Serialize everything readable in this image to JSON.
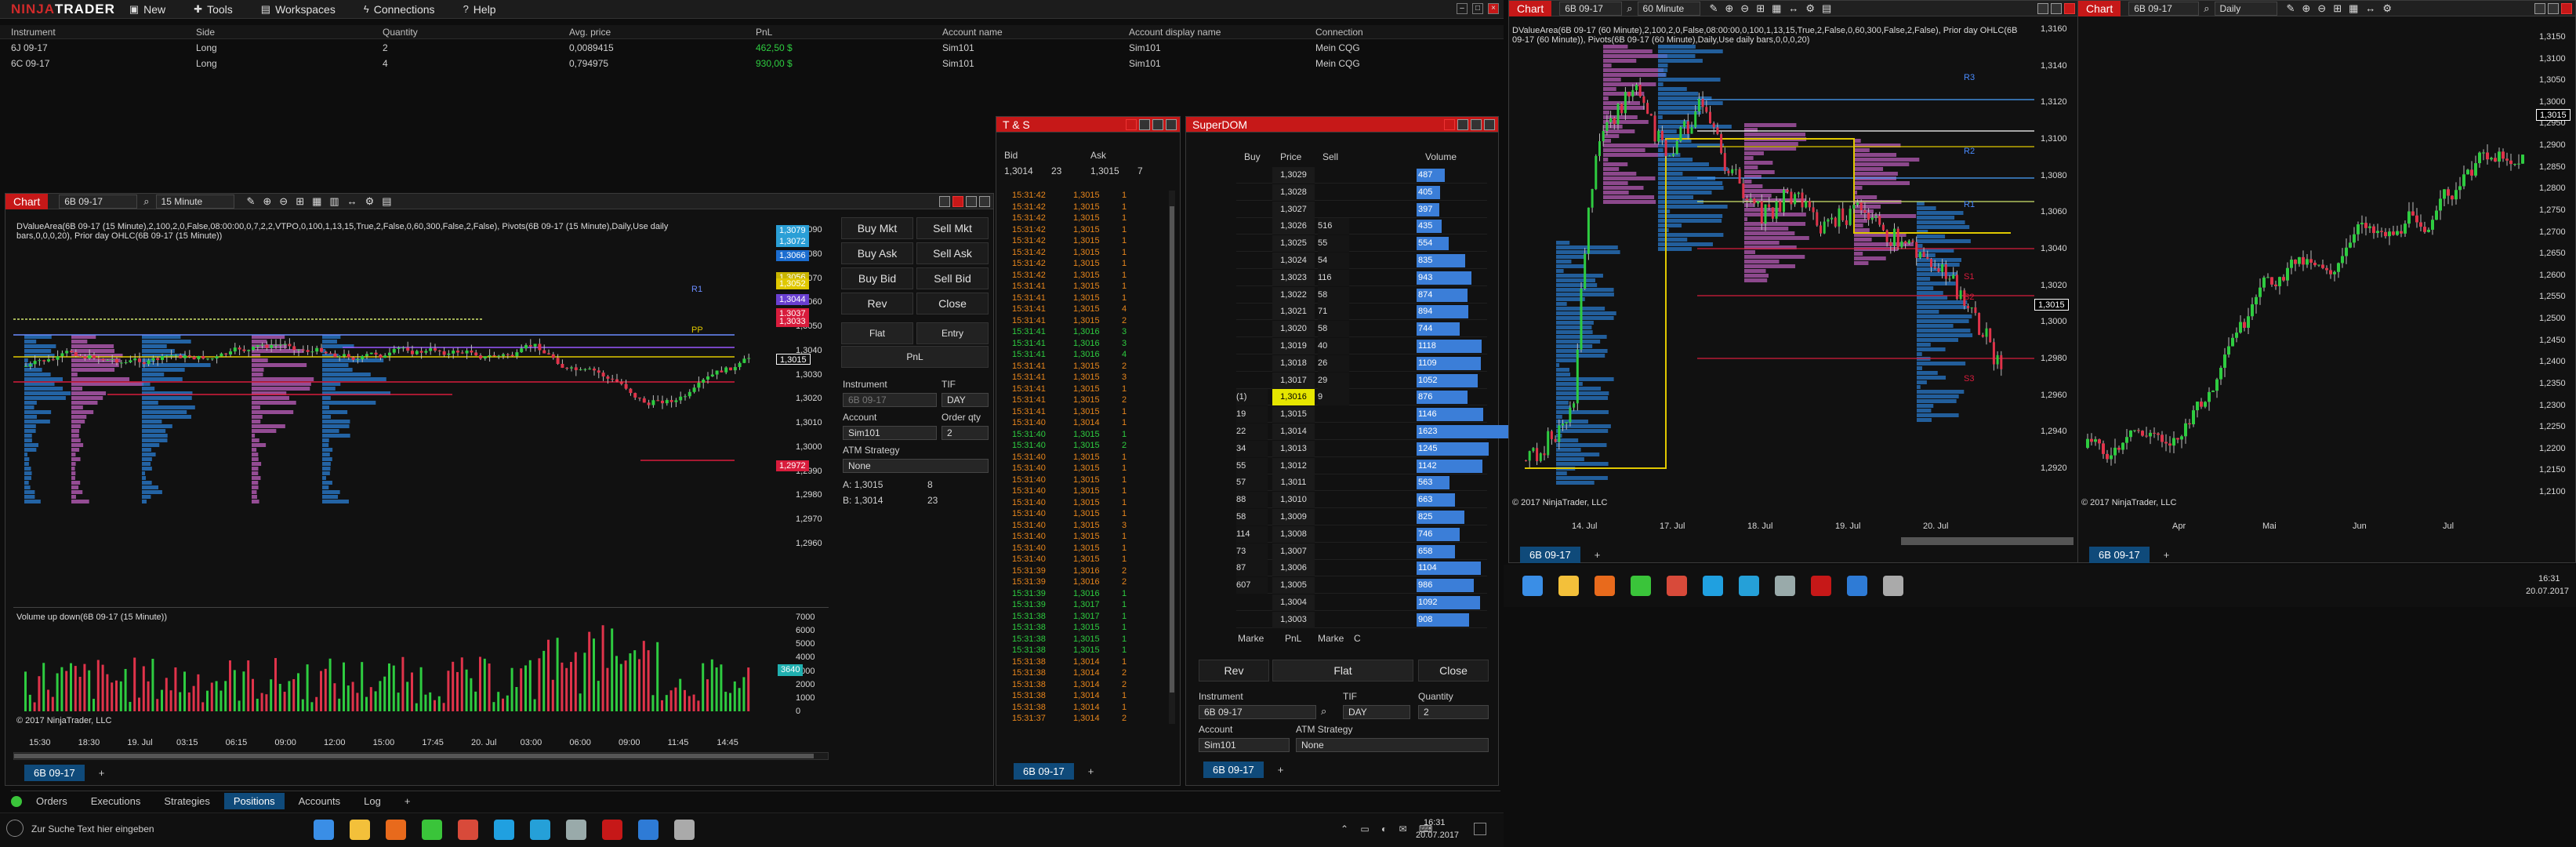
{
  "control_center": {
    "logo_a": "NINJA",
    "logo_b": "TRADER",
    "menu": [
      {
        "label": "New",
        "icon": "new-icon"
      },
      {
        "label": "Tools",
        "icon": "tools-icon"
      },
      {
        "label": "Workspaces",
        "icon": "workspaces-icon"
      },
      {
        "label": "Connections",
        "icon": "connections-icon"
      },
      {
        "label": "Help",
        "icon": "help-icon"
      }
    ],
    "positions": {
      "columns": [
        "Instrument",
        "Side",
        "Quantity",
        "Avg. price",
        "PnL",
        "Account name",
        "Account display name",
        "Connection"
      ],
      "rows": [
        [
          "6J 09-17",
          "Long",
          "2",
          "0,0089415",
          "462,50 $",
          "Sim101",
          "Sim101",
          "Mein CQG"
        ],
        [
          "6C 09-17",
          "Long",
          "4",
          "0,794975",
          "930,00 $",
          "Sim101",
          "Sim101",
          "Mein CQG"
        ]
      ]
    },
    "bottom_tabs": [
      "Orders",
      "Executions",
      "Strategies",
      "Positions",
      "Accounts",
      "Log"
    ],
    "active_tab": "Positions",
    "add_tab": "+"
  },
  "chart_15m": {
    "title": "Chart",
    "instrument": "6B 09-17",
    "interval": "15 Minute",
    "indicator_line": "DValueArea(6B 09-17 (15 Minute),2,100,2,0,False,08:00:00,0,7,2,2,VTPO,0,100,1,13,15,True,2,False,0,60,300,False,2,False), Pivots(6B 09-17 (15 Minute),Daily,Use daily bars,0,0,0,20), Prior day OHLC(6B 09-17 (15 Minute))",
    "price_axis": [
      "1,3090",
      "1,3080",
      "1,3070",
      "1,3060",
      "1,3050",
      "1,3040",
      "1,3030",
      "1,3020",
      "1,3010",
      "1,3000",
      "1,2990",
      "1,2980",
      "1,2970",
      "1,2960"
    ],
    "price_tags": [
      {
        "value": "1,3079",
        "color": "#2a9fd6"
      },
      {
        "value": "1,3072",
        "color": "#2a9fd6"
      },
      {
        "value": "1,3066",
        "color": "#1b6dd0"
      },
      {
        "value": "1,3056",
        "color": "#c8b400"
      },
      {
        "value": "1,3052",
        "color": "#e0c800"
      },
      {
        "value": "1,3044",
        "color": "#6a3fd0"
      },
      {
        "value": "1,3037",
        "color": "#d81c3c"
      },
      {
        "value": "1,3033",
        "color": "#d81c3c"
      },
      {
        "value": "1,3015",
        "color": "#111111"
      },
      {
        "value": "1,2972",
        "color": "#d81c3c"
      }
    ],
    "pivot_labels": [
      "R1",
      "PP"
    ],
    "time_axis": [
      "15:30",
      "18:30",
      "19. Jul",
      "03:15",
      "06:15",
      "09:00",
      "12:00",
      "15:00",
      "17:45",
      "20. Jul",
      "03:00",
      "06:00",
      "09:00",
      "11:45",
      "14:45"
    ],
    "volume_title": "Volume up down(6B 09-17 (15 Minute))",
    "volume_axis": [
      "7000",
      "6000",
      "5000",
      "4000",
      "3000",
      "2000",
      "1000",
      "0"
    ],
    "volume_tag": "3640",
    "copyright": "© 2017 NinjaTrader, LLC",
    "tab": "6B 09-17"
  },
  "chart_trader": {
    "buttons": [
      "Buy Mkt",
      "Sell Mkt",
      "Buy Ask",
      "Sell Ask",
      "Buy Bid",
      "Sell Bid",
      "Rev",
      "Close"
    ],
    "position_buttons": [
      "Flat",
      "Entry"
    ],
    "pnl": "PnL",
    "instrument_label": "Instrument",
    "instrument": "6B 09-17",
    "tif_label": "TIF",
    "tif": "DAY",
    "account_label": "Account",
    "account": "Sim101",
    "qty_label": "Order qty",
    "qty": "2",
    "atm_label": "ATM Strategy",
    "atm": "None",
    "quote_a": "A:",
    "ask": "1,3015",
    "ask_size": "8",
    "quote_b": "B:",
    "bid": "1,3014",
    "bid_size": "23"
  },
  "ts": {
    "title": "T & S",
    "bid_label": "Bid",
    "ask_label": "Ask",
    "bid": "1,3014",
    "bid_size": "23",
    "ask": "1,3015",
    "ask_size": "7",
    "rows": [
      [
        "15:31:42",
        "1,3015",
        "1",
        "o"
      ],
      [
        "15:31:42",
        "1,3015",
        "1",
        "o"
      ],
      [
        "15:31:42",
        "1,3015",
        "1",
        "o"
      ],
      [
        "15:31:42",
        "1,3015",
        "1",
        "o"
      ],
      [
        "15:31:42",
        "1,3015",
        "1",
        "o"
      ],
      [
        "15:31:42",
        "1,3015",
        "1",
        "o"
      ],
      [
        "15:31:42",
        "1,3015",
        "1",
        "o"
      ],
      [
        "15:31:42",
        "1,3015",
        "1",
        "o"
      ],
      [
        "15:31:41",
        "1,3015",
        "1",
        "o"
      ],
      [
        "15:31:41",
        "1,3015",
        "1",
        "o"
      ],
      [
        "15:31:41",
        "1,3015",
        "4",
        "o"
      ],
      [
        "15:31:41",
        "1,3015",
        "2",
        "o"
      ],
      [
        "15:31:41",
        "1,3016",
        "3",
        "g"
      ],
      [
        "15:31:41",
        "1,3016",
        "3",
        "g"
      ],
      [
        "15:31:41",
        "1,3016",
        "4",
        "g"
      ],
      [
        "15:31:41",
        "1,3015",
        "2",
        "o"
      ],
      [
        "15:31:41",
        "1,3015",
        "3",
        "o"
      ],
      [
        "15:31:41",
        "1,3015",
        "1",
        "o"
      ],
      [
        "15:31:41",
        "1,3015",
        "2",
        "o"
      ],
      [
        "15:31:41",
        "1,3015",
        "1",
        "o"
      ],
      [
        "15:31:40",
        "1,3014",
        "1",
        "o"
      ],
      [
        "15:31:40",
        "1,3015",
        "1",
        "g"
      ],
      [
        "15:31:40",
        "1,3015",
        "2",
        "g"
      ],
      [
        "15:31:40",
        "1,3015",
        "1",
        "o"
      ],
      [
        "15:31:40",
        "1,3015",
        "1",
        "o"
      ],
      [
        "15:31:40",
        "1,3015",
        "1",
        "o"
      ],
      [
        "15:31:40",
        "1,3015",
        "1",
        "o"
      ],
      [
        "15:31:40",
        "1,3015",
        "1",
        "o"
      ],
      [
        "15:31:40",
        "1,3015",
        "1",
        "o"
      ],
      [
        "15:31:40",
        "1,3015",
        "3",
        "o"
      ],
      [
        "15:31:40",
        "1,3015",
        "1",
        "o"
      ],
      [
        "15:31:40",
        "1,3015",
        "1",
        "o"
      ],
      [
        "15:31:40",
        "1,3015",
        "1",
        "o"
      ],
      [
        "15:31:39",
        "1,3016",
        "2",
        "o"
      ],
      [
        "15:31:39",
        "1,3016",
        "2",
        "o"
      ],
      [
        "15:31:39",
        "1,3016",
        "1",
        "g"
      ],
      [
        "15:31:39",
        "1,3017",
        "1",
        "g"
      ],
      [
        "15:31:38",
        "1,3017",
        "1",
        "g"
      ],
      [
        "15:31:38",
        "1,3015",
        "1",
        "g"
      ],
      [
        "15:31:38",
        "1,3015",
        "1",
        "g"
      ],
      [
        "15:31:38",
        "1,3015",
        "1",
        "g"
      ],
      [
        "15:31:38",
        "1,3014",
        "1",
        "o"
      ],
      [
        "15:31:38",
        "1,3014",
        "2",
        "o"
      ],
      [
        "15:31:38",
        "1,3014",
        "2",
        "o"
      ],
      [
        "15:31:38",
        "1,3014",
        "1",
        "o"
      ],
      [
        "15:31:38",
        "1,3014",
        "1",
        "o"
      ],
      [
        "15:31:37",
        "1,3014",
        "2",
        "o"
      ]
    ],
    "tab": "6B 09-17"
  },
  "superdom": {
    "title": "SuperDOM",
    "headers": [
      "Buy",
      "Price",
      "Sell",
      "Volume"
    ],
    "rows": [
      {
        "buy": "",
        "price": "1,3029",
        "sell": "",
        "vol": "487"
      },
      {
        "buy": "",
        "price": "1,3028",
        "sell": "",
        "vol": "405"
      },
      {
        "buy": "",
        "price": "1,3027",
        "sell": "",
        "vol": "397"
      },
      {
        "buy": "",
        "price": "1,3026",
        "sell": "516",
        "vol": "435"
      },
      {
        "buy": "",
        "price": "1,3025",
        "sell": "55",
        "vol": "554"
      },
      {
        "buy": "",
        "price": "1,3024",
        "sell": "54",
        "vol": "835"
      },
      {
        "buy": "",
        "price": "1,3023",
        "sell": "116",
        "vol": "943"
      },
      {
        "buy": "",
        "price": "1,3022",
        "sell": "58",
        "vol": "874"
      },
      {
        "buy": "",
        "price": "1,3021",
        "sell": "71",
        "vol": "894"
      },
      {
        "buy": "",
        "price": "1,3020",
        "sell": "58",
        "vol": "744"
      },
      {
        "buy": "",
        "price": "1,3019",
        "sell": "40",
        "vol": "1118"
      },
      {
        "buy": "",
        "price": "1,3018",
        "sell": "26",
        "vol": "1109"
      },
      {
        "buy": "",
        "price": "1,3017",
        "sell": "29",
        "vol": "1052"
      },
      {
        "buy": "(1)",
        "price": "1,3016",
        "sell": "9",
        "vol": "876"
      },
      {
        "buy": "19",
        "price": "1,3015",
        "sell": "",
        "vol": "1146"
      },
      {
        "buy": "22",
        "price": "1,3014",
        "sell": "",
        "vol": "1623"
      },
      {
        "buy": "34",
        "price": "1,3013",
        "sell": "",
        "vol": "1245"
      },
      {
        "buy": "55",
        "price": "1,3012",
        "sell": "",
        "vol": "1142"
      },
      {
        "buy": "57",
        "price": "1,3011",
        "sell": "",
        "vol": "563"
      },
      {
        "buy": "88",
        "price": "1,3010",
        "sell": "",
        "vol": "663"
      },
      {
        "buy": "58",
        "price": "1,3009",
        "sell": "",
        "vol": "825"
      },
      {
        "buy": "114",
        "price": "1,3008",
        "sell": "",
        "vol": "746"
      },
      {
        "buy": "73",
        "price": "1,3007",
        "sell": "",
        "vol": "658"
      },
      {
        "buy": "87",
        "price": "1,3006",
        "sell": "",
        "vol": "1104"
      },
      {
        "buy": "607",
        "price": "1,3005",
        "sell": "",
        "vol": "986"
      },
      {
        "buy": "",
        "price": "1,3004",
        "sell": "",
        "vol": "1092"
      },
      {
        "buy": "",
        "price": "1,3003",
        "sell": "",
        "vol": "908"
      }
    ],
    "volume_max": 1623,
    "footer": [
      "Marke",
      "PnL",
      "Marke",
      "C"
    ],
    "rev": "Rev",
    "flat": "Flat",
    "close": "Close",
    "instrument_label": "Instrument",
    "instrument": "6B 09-17",
    "tif_label": "TIF",
    "tif": "DAY",
    "qty_label": "Quantity",
    "qty": "2",
    "account_label": "Account",
    "account": "Sim101",
    "atm_label": "ATM Strategy",
    "atm": "None",
    "tab": "6B 09-17"
  },
  "chart_60m": {
    "title": "Chart",
    "instrument": "6B 09-17",
    "interval": "60 Minute",
    "indicator_line": "DValueArea(6B 09-17 (60 Minute),2,100,2,0,False,08:00:00,0,100,1,13,15,True,2,False,0,60,300,False,2,False), Prior day OHLC(6B 09-17 (60 Minute)), Pivots(6B 09-17 (60 Minute),Daily,Use daily bars,0,0,0,20)",
    "price_axis": [
      "1,3160",
      "1,3140",
      "1,3120",
      "1,3100",
      "1,3080",
      "1,3060",
      "1,3040",
      "1,3020",
      "1,3000",
      "1,2980",
      "1,2960",
      "1,2940",
      "1,2920"
    ],
    "current_price": "1,3015",
    "pivot_labels": [
      "R3",
      "R2",
      "R1",
      "S1",
      "S2",
      "S3"
    ],
    "time_axis": [
      "14. Jul",
      "17. Jul",
      "18. Jul",
      "19. Jul",
      "20. Jul"
    ],
    "copyright": "© 2017 NinjaTrader, LLC",
    "tab": "6B 09-17"
  },
  "chart_daily": {
    "title": "Chart",
    "instrument": "6B 09-17",
    "interval": "Daily",
    "price_axis": [
      "1,3150",
      "1,3100",
      "1,3050",
      "1,3000",
      "1,2950",
      "1,2900",
      "1,2850",
      "1,2800",
      "1,2750",
      "1,2700",
      "1,2650",
      "1,2600",
      "1,2550",
      "1,2500",
      "1,2450",
      "1,2400",
      "1,2350",
      "1,2300",
      "1,2250",
      "1,2200",
      "1,2150",
      "1,2100"
    ],
    "current_price": "1,3015",
    "time_axis": [
      "Apr",
      "Mai",
      "Jun",
      "Jul"
    ],
    "copyright": "© 2017 NinjaTrader, LLC",
    "tab": "6B 09-17"
  },
  "taskbar_left": {
    "search_placeholder": "Zur Suche Text hier eingeben",
    "time": "16:31",
    "date": "20.07.2017"
  },
  "taskbar_right": {
    "time": "16:31",
    "date": "20.07.2017"
  }
}
